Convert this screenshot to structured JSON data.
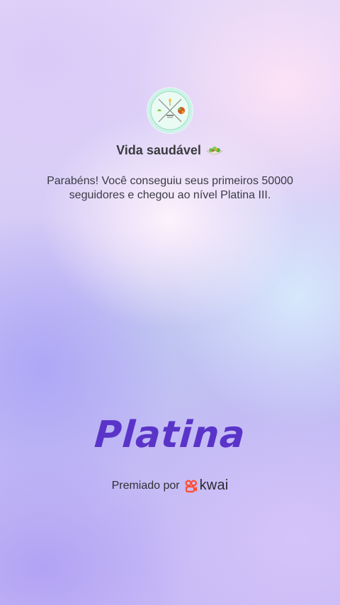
{
  "profile": {
    "name": "Vida saudável",
    "avatar_icon": "healthy-plate-logo-icon",
    "name_icon": "salad-icon"
  },
  "message": "Parabéns! Você conseguiu seus primeiros 50000 seguidores e chegou ao nível Platina III.",
  "level": {
    "label": "Platina",
    "color": "#5a34c8"
  },
  "award": {
    "prefix": "Premiado por",
    "brand_name": "kwai",
    "brand_icon": "kwai-logo-icon",
    "brand_color": "#ff4d2e"
  }
}
